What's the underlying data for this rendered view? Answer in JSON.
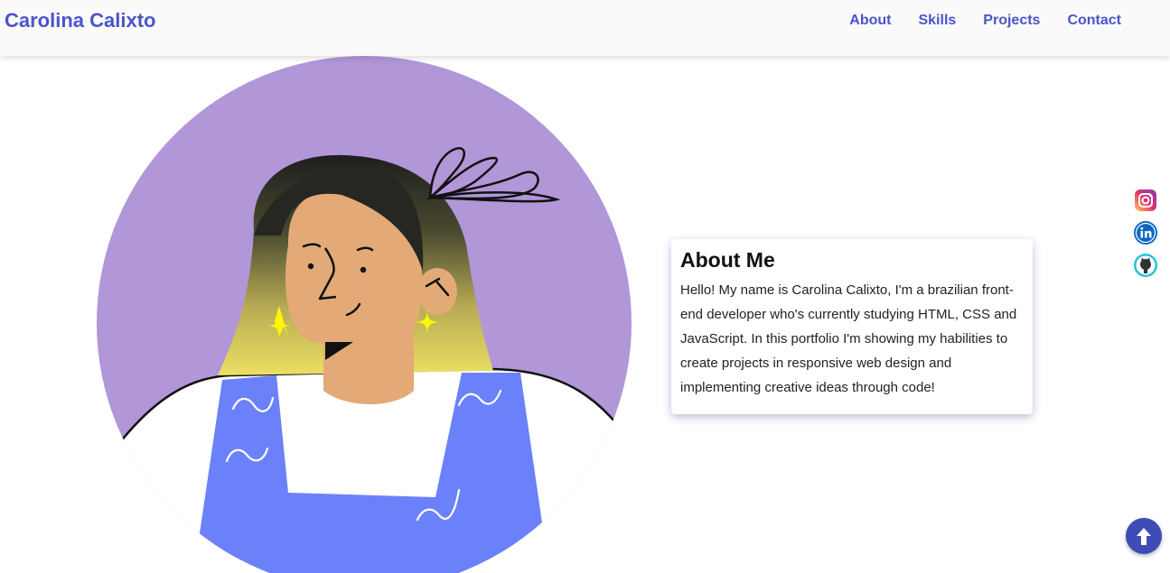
{
  "nav": {
    "brand": "Carolina Calixto",
    "links": [
      {
        "label": "About"
      },
      {
        "label": "Skills"
      },
      {
        "label": "Projects"
      },
      {
        "label": "Contact"
      }
    ]
  },
  "about": {
    "title": "About Me",
    "text": "Hello! My name is Carolina Calixto, I'm a brazilian front-end developer who's currently studying HTML, CSS and JavaScript. In this portfolio I'm showing my habilities to create projects in responsive web design and implementing creative ideas through code!"
  },
  "social": {
    "items": [
      {
        "icon": "instagram-icon"
      },
      {
        "icon": "linkedin-icon"
      },
      {
        "icon": "github-icon"
      }
    ]
  },
  "colors": {
    "brand": "#4a55c9",
    "avatar_bg": "#b196d8",
    "overalls": "#6b81fa",
    "skin": "#e3aa77",
    "earring": "#fbf707",
    "scroll_button": "#3f4cb8"
  },
  "scroll_top": {
    "icon": "arrow-up-icon"
  }
}
